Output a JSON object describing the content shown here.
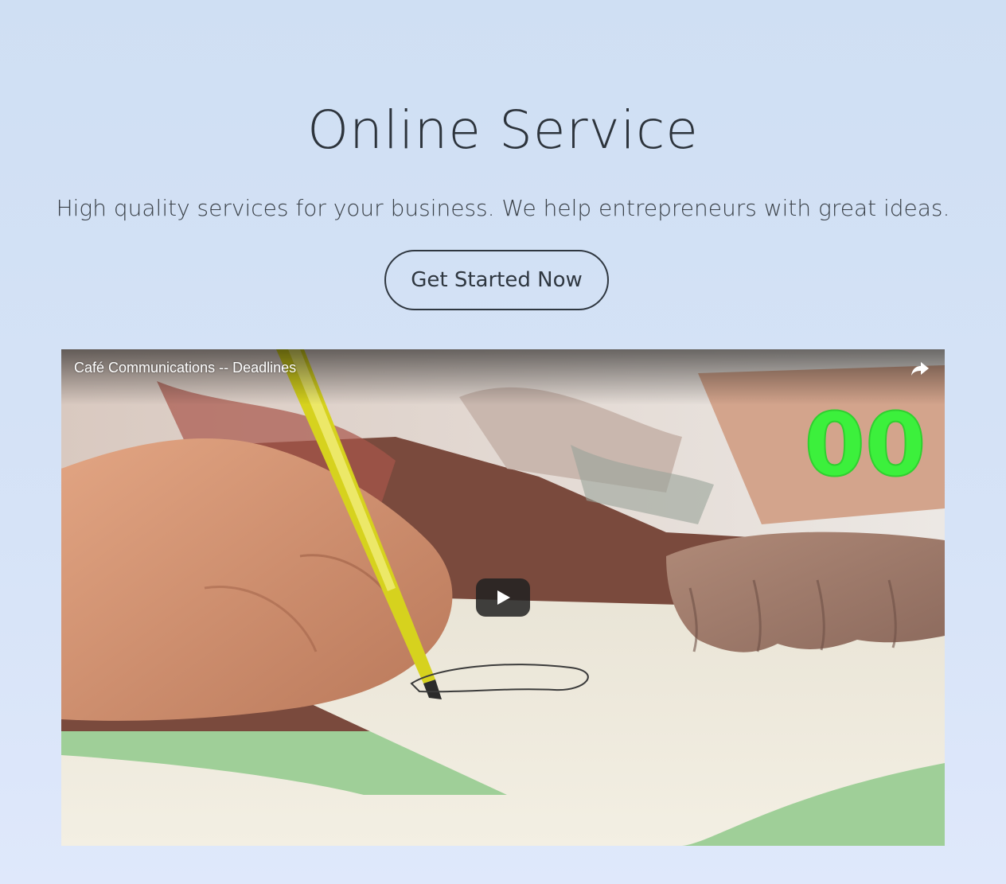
{
  "hero": {
    "title": "Online Service",
    "subtitle": "High quality services for your business. We help entrepreneurs with great ideas.",
    "cta_label": "Get Started Now"
  },
  "video": {
    "title": "Café Communications -- Deadlines",
    "counter_text": "00",
    "icons": [
      "share-icon",
      "play-icon"
    ]
  },
  "colors": {
    "background_top": "#cfdff3",
    "background_bottom": "#dfe8fb",
    "text": "#2d343c",
    "counter_green": "#3cf03c",
    "play_button": "#212121"
  }
}
